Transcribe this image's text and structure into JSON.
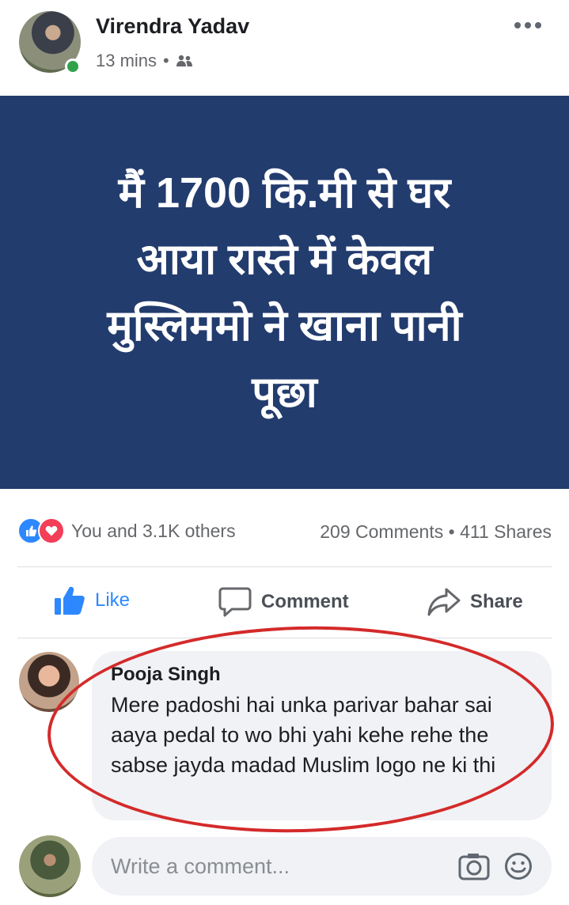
{
  "post": {
    "author": "Virendra Yadav",
    "time": "13 mins",
    "separator": "•",
    "audience_icon": "friends-icon",
    "more_icon": "more-options-icon",
    "image_text": "मैं 1700 कि.मी से घर\nआया रास्ते में केवल\nमुस्लिममो ने खाना पानी\nपूछा",
    "image_bg": "#233c6e"
  },
  "engagement": {
    "reactions_text": "You and 3.1K others",
    "comments": "209 Comments",
    "dot": "•",
    "shares": "411 Shares"
  },
  "actions": {
    "like": "Like",
    "comment": "Comment",
    "share": "Share"
  },
  "comment": {
    "author": "Pooja Singh",
    "text": "Mere padoshi hai unka parivar bahar sai aaya pedal to wo bhi yahi kehe rehe the sabse jayda madad Muslim logo ne ki thi",
    "highlight_color": "#d42a2a"
  },
  "composer": {
    "placeholder": "Write a comment...",
    "camera_icon": "camera-icon",
    "emoji_icon": "emoji-icon"
  },
  "colors": {
    "accent": "#2d88ff",
    "online": "#31a24c"
  }
}
